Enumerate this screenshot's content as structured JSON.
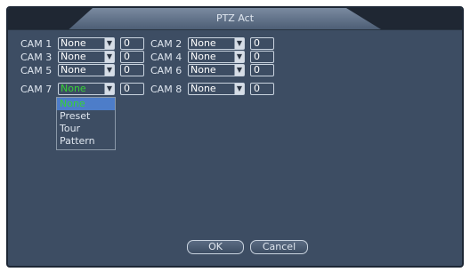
{
  "title": "PTZ Act",
  "cams": [
    {
      "left": {
        "label": "CAM 1",
        "value": "None",
        "num": "0"
      },
      "right": {
        "label": "CAM 2",
        "value": "None",
        "num": "0"
      }
    },
    {
      "left": {
        "label": "CAM 3",
        "value": "None",
        "num": "0"
      },
      "right": {
        "label": "CAM 4",
        "value": "None",
        "num": "0"
      }
    },
    {
      "left": {
        "label": "CAM 5",
        "value": "None",
        "num": "0"
      },
      "right": {
        "label": "CAM 6",
        "value": "None",
        "num": "0"
      }
    },
    {
      "left": {
        "label": "CAM 7",
        "value": "None",
        "num": "0"
      },
      "right": {
        "label": "CAM 8",
        "value": "None",
        "num": "0"
      }
    }
  ],
  "dropdown": {
    "options": [
      "None",
      "Preset",
      "Tour",
      "Pattern"
    ],
    "highlighted": "None"
  },
  "buttons": {
    "ok": "OK",
    "cancel": "Cancel"
  },
  "icons": {
    "select_arrow": "chevron-down-icon"
  },
  "colors": {
    "panel_bg": "#3d4d63",
    "text": "#dfe6ef",
    "active_value": "#36d236",
    "highlight_bg": "#4d7dc9"
  }
}
